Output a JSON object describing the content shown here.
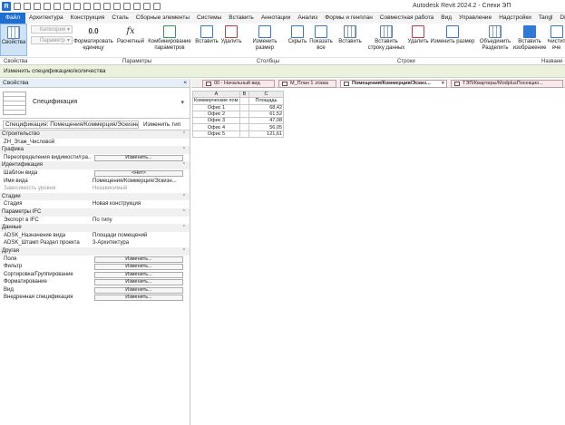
{
  "app": {
    "title": "Autodesk Revit 2024.2 - Спеки ЭП",
    "logo": "R"
  },
  "ribbon_tabs": [
    "Файл",
    "Архитектура",
    "Конструкция",
    "Сталь",
    "Сборные элементы",
    "Системы",
    "Вставить",
    "Аннотации",
    "Анализ",
    "Формы и генплан",
    "Совместная работа",
    "Вид",
    "Управление",
    "Надстройки",
    "Tangl",
    "DiRoots"
  ],
  "ribbon": {
    "properties_button": "Свойства",
    "category_placeholder": "Категория",
    "parameter_placeholder": "Параметр",
    "buttons": [
      "Форматировать единицу",
      "Расчетный",
      "Комбинирование параметров",
      "Вставить",
      "Удалить",
      "Изменить размер",
      "Скрыть",
      "Показать все",
      "Вставить",
      "Вставить строку данных",
      "Удалить",
      "Изменить размер",
      "Объединить Разделить",
      "Вставить изображение",
      "Очистить яче"
    ],
    "groups": [
      "Свойства",
      "Параметры",
      "Столбцы",
      "Строки",
      "Названи"
    ]
  },
  "context_bar": "Изменить спецификацию/количества",
  "properties": {
    "header": "Свойства",
    "close": "×",
    "type_name": "Спецификация",
    "instance_selector": "Спецификация: Помещения/Коммерция/Эскизный п",
    "edit_type": "Изменить тип",
    "rows": [
      {
        "kind": "group",
        "label": "Строительство"
      },
      {
        "kind": "row",
        "label": "ZH_Этаж_Числовой",
        "value": ""
      },
      {
        "kind": "group",
        "label": "Графика"
      },
      {
        "kind": "button",
        "label": "Переопределения видимости/гра...",
        "value": "Изменить..."
      },
      {
        "kind": "group",
        "label": "Идентификация"
      },
      {
        "kind": "button",
        "label": "Шаблон вида",
        "value": "<Нет>"
      },
      {
        "kind": "row",
        "label": "Имя вида",
        "value": "Помещения/Коммерция/Эскизн..."
      },
      {
        "kind": "row-grey",
        "label": "Зависимость уровня",
        "value": "Независимый"
      },
      {
        "kind": "group",
        "label": "Стадии"
      },
      {
        "kind": "row",
        "label": "Стадия",
        "value": "Новая конструкция"
      },
      {
        "kind": "group",
        "label": "Параметры IFC"
      },
      {
        "kind": "row",
        "label": "Экспорт в IFC",
        "value": "По типу"
      },
      {
        "kind": "group",
        "label": "Данные"
      },
      {
        "kind": "row",
        "label": "ADSK_Назначение вида",
        "value": "Площади помещений"
      },
      {
        "kind": "row",
        "label": "ADSK_Штамп Раздел проекта",
        "value": "3-Архитектура"
      },
      {
        "kind": "group",
        "label": "Другая"
      },
      {
        "kind": "button",
        "label": "Поля",
        "value": "Изменить..."
      },
      {
        "kind": "button",
        "label": "Фильтр",
        "value": "Изменить..."
      },
      {
        "kind": "button",
        "label": "Сортировка/Группирование",
        "value": "Изменить..."
      },
      {
        "kind": "button",
        "label": "Форматирование",
        "value": "Изменить..."
      },
      {
        "kind": "button",
        "label": "Вид",
        "value": "Изменить..."
      },
      {
        "kind": "button",
        "label": "Внедренная спецификация",
        "value": "Изменить..."
      }
    ]
  },
  "doc_tabs": [
    {
      "label": "00 - Начальный вид",
      "active": false
    },
    {
      "label": "M_План 1 этажа",
      "active": false
    },
    {
      "label": "Помещения/Коммерция/Эскиз...",
      "active": true,
      "close": "×"
    },
    {
      "label": "ТЭП/Квартиры/ModplusПосекцио...",
      "active": false
    }
  ],
  "schedule": {
    "column_letters": [
      "A",
      "B",
      "C"
    ],
    "headers": [
      "Коммерческие пом",
      "",
      "Площадь"
    ],
    "rows": [
      [
        "Офис 1",
        "",
        "68,42"
      ],
      [
        "Офис 2",
        "",
        "61,52"
      ],
      [
        "Офис 3",
        "",
        "47,08"
      ],
      [
        "Офис 4",
        "",
        "56,05"
      ],
      [
        "Офис 5",
        "",
        "121,61"
      ]
    ]
  }
}
